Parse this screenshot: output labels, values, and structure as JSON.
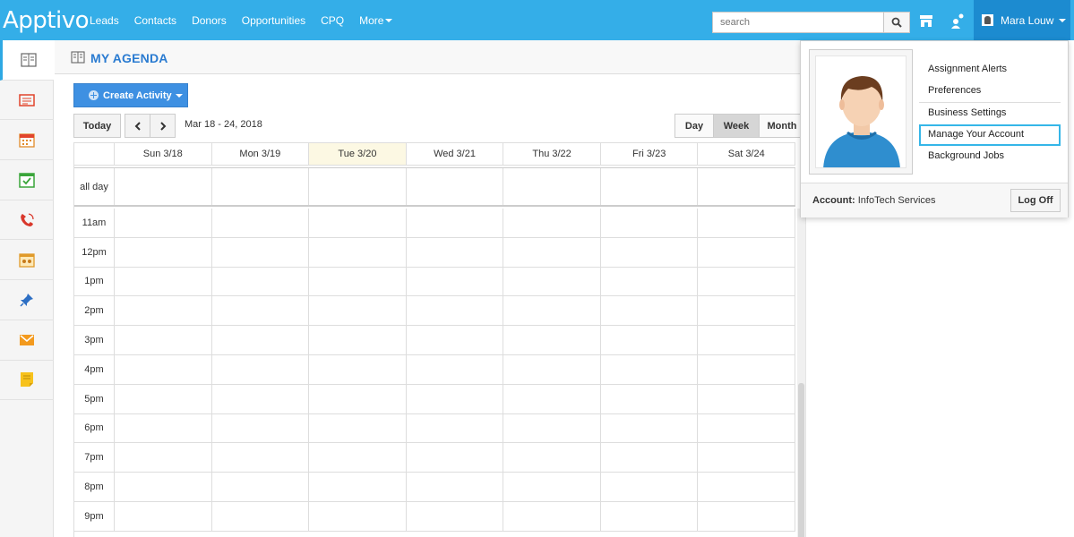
{
  "app": {
    "logo_text": "Apptivo"
  },
  "nav": {
    "items": [
      {
        "label": "Leads"
      },
      {
        "label": "Contacts"
      },
      {
        "label": "Donors"
      },
      {
        "label": "Opportunities"
      },
      {
        "label": "CPQ"
      },
      {
        "label": "More"
      }
    ]
  },
  "search": {
    "placeholder": "search"
  },
  "user": {
    "name": "Mara Louw"
  },
  "sidebar": {
    "items": [
      {
        "icon": "agenda-icon"
      },
      {
        "icon": "list-icon"
      },
      {
        "icon": "calendar-icon"
      },
      {
        "icon": "task-icon"
      },
      {
        "icon": "phone-icon"
      },
      {
        "icon": "meeting-icon"
      },
      {
        "icon": "pin-icon"
      },
      {
        "icon": "mail-icon"
      },
      {
        "icon": "note-icon"
      }
    ]
  },
  "page": {
    "title": "MY AGENDA"
  },
  "toolbar": {
    "create_label": "Create Activity",
    "today_label": "Today",
    "date_range": "Mar 18 - 24, 2018",
    "views": {
      "day": "Day",
      "week": "Week",
      "month": "Month"
    }
  },
  "calendar": {
    "days": [
      "Sun 3/18",
      "Mon 3/19",
      "Tue 3/20",
      "Wed 3/21",
      "Thu 3/22",
      "Fri 3/23",
      "Sat 3/24"
    ],
    "allday_label": "all day",
    "times": [
      "11am",
      "12pm",
      "1pm",
      "2pm",
      "3pm",
      "4pm",
      "5pm",
      "6pm",
      "7pm",
      "8pm",
      "9pm"
    ]
  },
  "dropdown": {
    "menu": [
      "Assignment Alerts",
      "Preferences",
      "Business Settings",
      "Manage Your Account",
      "Background Jobs"
    ],
    "account_label": "Account:",
    "account_name": "InfoTech Services",
    "logoff_label": "Log Off"
  },
  "colors": {
    "brand": "#34aee8",
    "accent": "#3e90e2",
    "highlight": "#35b6e8"
  }
}
